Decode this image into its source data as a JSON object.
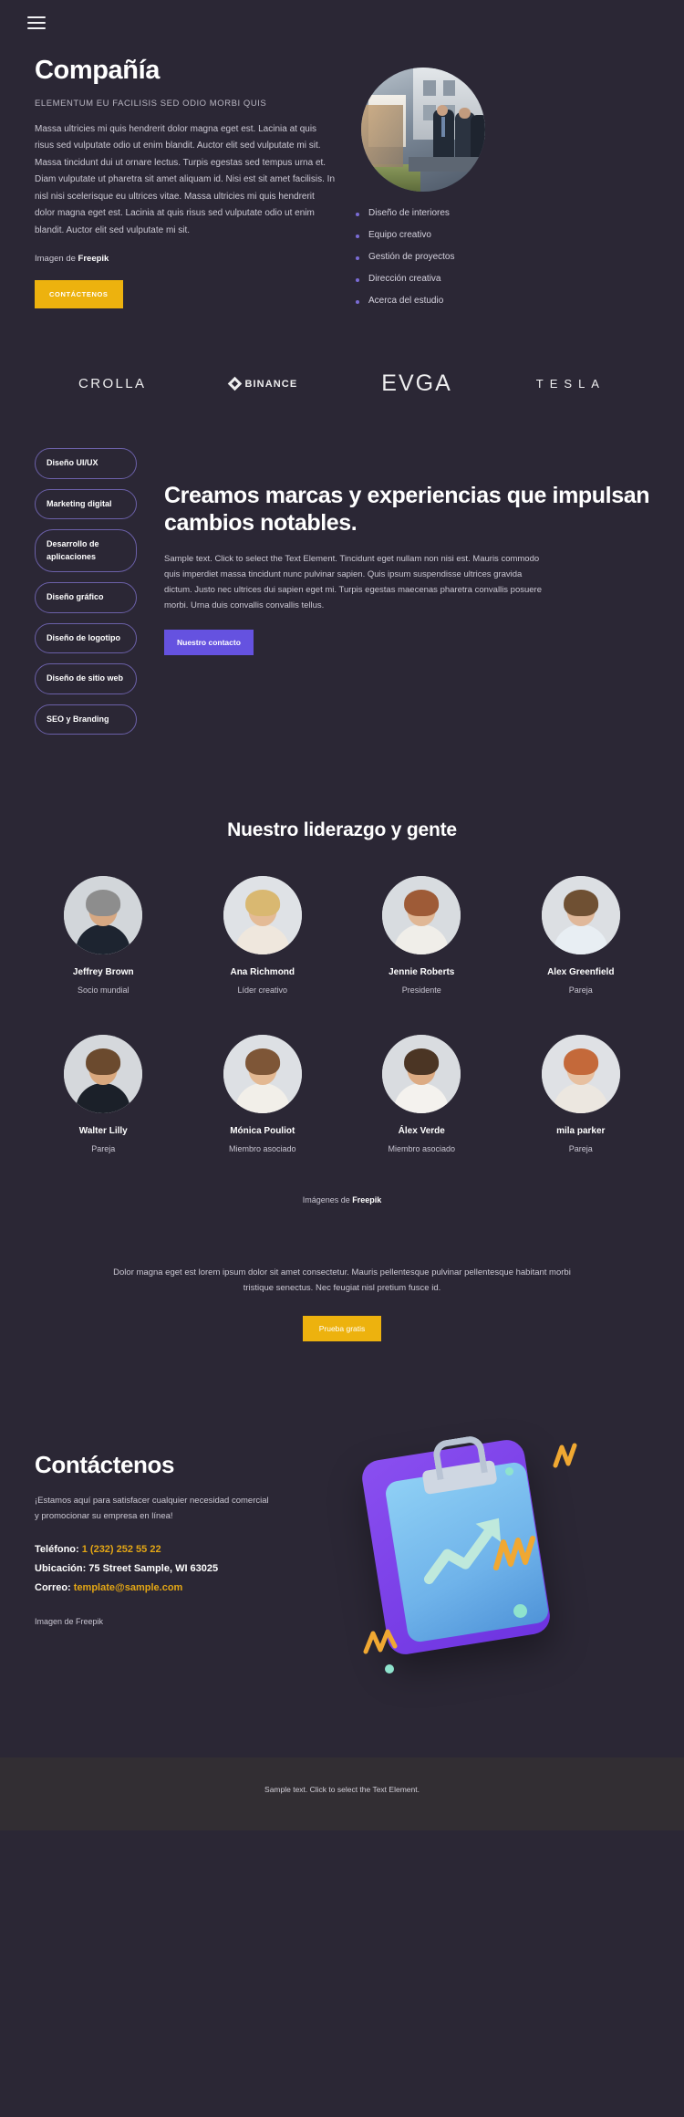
{
  "theme": {
    "background": "#2b2735",
    "footer_background": "#322e33",
    "accent_yellow": "#edb20e",
    "accent_purple": "#6552e0",
    "pill_border": "#6b60a8",
    "bullet_color": "#7a6bd4",
    "text_primary": "#ffffff",
    "text_muted": "#ccc9d4"
  },
  "header": {
    "menu_icon": "hamburger-menu-icon"
  },
  "hero": {
    "title": "Compañía",
    "subtitle": "ELEMENTUM EU FACILISIS SED ODIO MORBI QUIS",
    "body": "Massa ultricies mi quis hendrerit dolor magna eget est. Lacinia at quis risus sed vulputate odio ut enim blandit. Auctor elit sed vulputate mi sit. Massa tincidunt dui ut ornare lectus. Turpis egestas sed tempus urna et. Diam vulputate ut pharetra sit amet aliquam id. Nisi est sit amet facilisis. In nisl nisi scelerisque eu ultrices vitae. Massa ultricies mi quis hendrerit dolor magna eget est. Lacinia at quis risus sed vulputate odio ut enim blandit. Auctor elit sed vulputate mi sit.",
    "credit_prefix": "Imagen de ",
    "credit_source": "Freepik",
    "cta_label": "CONTÁCTENOS",
    "photo_alt": "business-team-photo",
    "service_list": [
      "Diseño de interiores",
      "Equipo creativo",
      "Gestión de proyectos",
      "Dirección creativa",
      "Acerca del estudio"
    ]
  },
  "logos": [
    {
      "name": "CROLLA",
      "icon": "crolla-logo"
    },
    {
      "name": "BINANCE",
      "icon": "binance-logo"
    },
    {
      "name": "EVGA",
      "icon": "evga-logo"
    },
    {
      "name": "TESLA",
      "icon": "tesla-logo"
    }
  ],
  "services": {
    "pills": [
      "Diseño UI/UX",
      "Marketing digital",
      "Desarrollo de aplicaciones",
      "Diseño gráfico",
      "Diseño de logotipo",
      "Diseño de sitio web",
      "SEO y Branding"
    ],
    "headline": "Creamos marcas y experiencias que impulsan cambios notables.",
    "body": "Sample text. Click to select the Text Element. Tincidunt eget nullam non nisi est. Mauris commodo quis imperdiet massa tincidunt nunc pulvinar sapien. Quis ipsum suspendisse ultrices gravida dictum. Justo nec ultrices dui sapien eget mi. Turpis egestas maecenas pharetra convallis posuere morbi. Urna duis convallis convallis tellus.",
    "cta_label": "Nuestro contacto"
  },
  "team": {
    "title": "Nuestro liderazgo y gente",
    "members": [
      {
        "name": "Jeffrey Brown",
        "role": "Socio mundial",
        "skin": "#d7a882",
        "hair": "#8d8d8d",
        "clothes": "#1d2430",
        "bg": "#d2d6da"
      },
      {
        "name": "Ana Richmond",
        "role": "Líder creativo",
        "skin": "#e4bb96",
        "hair": "#d9b871",
        "clothes": "#efe7dd",
        "bg": "#dfe2e6"
      },
      {
        "name": "Jennie Roberts",
        "role": "Presidente",
        "skin": "#e0b795",
        "hair": "#9e5b37",
        "clothes": "#f0eee9",
        "bg": "#d8dce0"
      },
      {
        "name": "Alex Greenfield",
        "role": "Pareja",
        "skin": "#e0b89a",
        "hair": "#6f5033",
        "clothes": "#e8eef3",
        "bg": "#dcdfe3"
      },
      {
        "name": "Walter Lilly",
        "role": "Pareja",
        "skin": "#d9a87e",
        "hair": "#6b4a2e",
        "clothes": "#1b2029",
        "bg": "#d5d8dc"
      },
      {
        "name": "Mónica Pouliot",
        "role": "Miembro asociado",
        "skin": "#e3b892",
        "hair": "#7e5637",
        "clothes": "#f2efe9",
        "bg": "#dde0e4"
      },
      {
        "name": "Álex Verde",
        "role": "Miembro asociado",
        "skin": "#dcab83",
        "hair": "#4b3524",
        "clothes": "#f4f2ee",
        "bg": "#d9dce0"
      },
      {
        "name": "mila parker",
        "role": "Pareja",
        "skin": "#e7c0a0",
        "hair": "#c4693a",
        "clothes": "#ece7e0",
        "bg": "#dfe1e5"
      }
    ],
    "credit_prefix": "Imágenes de ",
    "credit_source": "Freepik"
  },
  "cta": {
    "text": "Dolor magna eget est lorem ipsum dolor sit amet consectetur. Mauris pellentesque pulvinar pellentesque habitant morbi tristique senectus. Nec feugiat nisl pretium fusce id.",
    "button_label": "Prueba gratis"
  },
  "contact": {
    "title": "Contáctenos",
    "lead": "¡Estamos aquí para satisfacer cualquier necesidad comercial y promocionar su empresa en línea!",
    "phone_label": "Teléfono: ",
    "phone_value": "1 (232) 252 55 22",
    "location_label": "Ubicación: ",
    "location_value": "75 Street Sample, WI 63025",
    "email_label": "Correo: ",
    "email_value": "template@sample.com",
    "credit": "Imagen de Freepik",
    "illustration_alt": "clipboard-growth-chart-illustration"
  },
  "footer": {
    "text": "Sample text. Click to select the Text Element."
  }
}
